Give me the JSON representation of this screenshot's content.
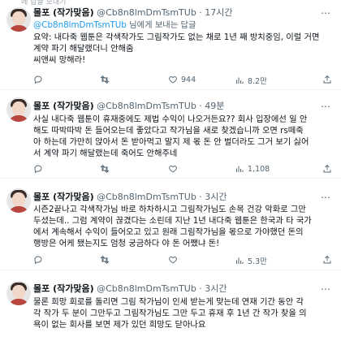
{
  "top_strip": {
    "text": "에 답글 보내기"
  },
  "tweets": [
    {
      "name": "몰포 (작가맞음)",
      "handle": "@Cb8n8lmDmTsmTUb",
      "dot": "·",
      "time": "17시간",
      "reply_to": "@Cb8n8lmDmTsmTUb",
      "reply_suffix": " 님에게 보내는 답글",
      "lines": [
        "요약: 내다죽 웹툰은 각색작가도 그림작가도 없는 채로 1년 째 방치중임, 이럴 거면",
        "계약 파기 해달랬더니 안해줌",
        "씨앤씨 망해라!"
      ],
      "reply_count": "",
      "retweet_count": "",
      "like_count": "944",
      "view_count": "8.2만"
    },
    {
      "name": "몰포 (작가맞음)",
      "handle": "@Cb8n8lmDmTsmTUb",
      "dot": "·",
      "time": "49분",
      "lines": [
        "사실 내다죽 웹툰이 휴재중에도 제법 수익이 나오거든요?? 회사 입장에선 일 안",
        "해도 따박따박 돈 들어오는데 좋았다고 작가님을 새로 찾겠습니까 오면 rs떼죽",
        "아 하는데 가만히 앉아서 돈 받아먹고 말지 제 몫 돈 안 벌더라도 그거 보기 싫어",
        "서 계약 파기 해달랬는데 죽어도 안해주네"
      ],
      "reply_count": "",
      "retweet_count": "",
      "like_count": "",
      "view_count": "1,108"
    },
    {
      "name": "몰포 (작가맞음)",
      "handle": "@Cb8n8lmDmTsmTUb",
      "dot": "·",
      "time": "3시간",
      "lines": [
        "시즌2끝나고 각색작가님 바로 하차하시고 그림작가님도 손목 건강 악화로 그만",
        "두셨는데.. 그럼 계약이 끊겼다는 소린데 지난 1년 내다죽 웹툰은 한국과 타 국가",
        "에서 계속해서 수익이 들어오고 있고 원래 그림작가님을 몫으로 가야했던 돈의",
        "행방은 어케 됐는지도 엄청 궁금하다 야 돈 어쨌냐 돈!"
      ],
      "reply_count": "",
      "retweet_count": "",
      "like_count": "",
      "view_count": "5.3만"
    },
    {
      "name": "몰포 (작가맞음)",
      "handle": "@Cb8n8lmDmTsmTUb",
      "dot": "·",
      "time": "3시간",
      "lines": [
        "물론 희망 회로를 돌리면 그림 작가님이 인세 받는게 맞는데 연재 기간 동안 각",
        "각 작가 두 분이 그만두고 그림작가님도 그만 두고 휴재 후 1년 간 작가 찾을 의",
        "욕이 없는 회사를 보면 제가 있던 희망도 닫아나요"
      ],
      "reply_count": "",
      "retweet_count": "",
      "like_count": "",
      "view_count": ""
    }
  ],
  "icons": {
    "more": "more-horizontal-icon",
    "reply": "reply-icon",
    "retweet": "retweet-icon",
    "like": "heart-icon",
    "views": "views-chart-icon",
    "share": "share-icon"
  },
  "more_glyph": "⋯"
}
